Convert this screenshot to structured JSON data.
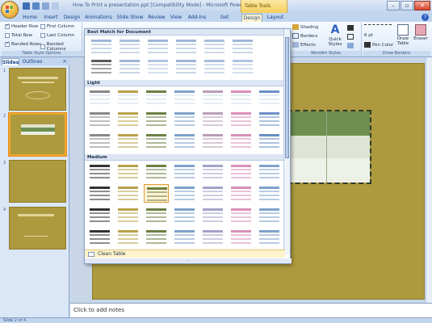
{
  "app": {
    "title": "How To Print a presentation.ppt [Compatibility Mode] - Microsoft PowerPoint",
    "contextual_label": "Table Tools",
    "accent": "#f5cf5d"
  },
  "window_controls": {
    "minimize": "–",
    "restore": "▫",
    "close": "✕"
  },
  "tabs": [
    {
      "label": "Home"
    },
    {
      "label": "Insert"
    },
    {
      "label": "Design"
    },
    {
      "label": "Animations"
    },
    {
      "label": "Slide Show"
    },
    {
      "label": "Review"
    },
    {
      "label": "View"
    },
    {
      "label": "Add-Ins"
    },
    {
      "label": "Get Started"
    },
    {
      "label": "Design"
    },
    {
      "label": "Layout"
    }
  ],
  "help_icon": "?",
  "ribbon": {
    "table_style_options": {
      "label": "Table Style Options",
      "header_row": "Header Row",
      "total_row": "Total Row",
      "banded_rows": "Banded Rows",
      "first_column": "First Column",
      "last_column": "Last Column",
      "banded_columns": "Banded Columns"
    },
    "shading": "Shading",
    "borders": "Borders",
    "effects": "Effects",
    "quick_styles": "Quick Styles",
    "wordart_label": "WordArt Styles",
    "pen_weight": "6 pt",
    "pen_color": "Pen Color",
    "draw_table": "Draw Table",
    "eraser": "Eraser",
    "draw_borders_label": "Draw Borders"
  },
  "left_pane": {
    "tab_slides": "Slides",
    "tab_outline": "Outlines",
    "close": "×",
    "slide_numbers": [
      "1",
      "2",
      "3",
      "4"
    ]
  },
  "gallery": {
    "section_best_match": "Best Match for Document",
    "section_light": "Light",
    "section_medium": "Medium",
    "clear_table": "Clean Table",
    "grip": "....",
    "best_match_colors": [
      "#9fb6d6",
      "#a8bedc",
      "#9fb6d6",
      "#9fb6d6",
      "#a8bedc",
      "#9fb6d6",
      "#5a5a5a",
      "#9fb6d6",
      "#b1c4e0",
      "#9fb6d6",
      "#a8bedc",
      "#b1c4e0"
    ],
    "light_row_colors": [
      "#888888",
      "#b9a24a",
      "#6d7f44",
      "#7ea1cc",
      "#b99eb8",
      "#d98fb9",
      "#6a8fc5"
    ],
    "medium_row_colors": [
      "#333333",
      "#b9a24a",
      "#6d7f44",
      "#7ea1cc",
      "#a2a2c9",
      "#d98fb9",
      "#7ea1cc"
    ]
  },
  "notes": {
    "placeholder": "Click to add notes"
  },
  "status": {
    "slide": "Slide 2 of 4"
  }
}
